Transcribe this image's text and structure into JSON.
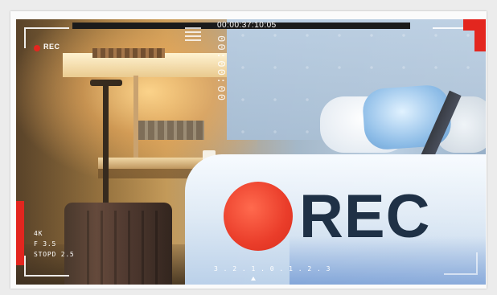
{
  "overlay": {
    "rec_label_small": "REC",
    "timecode": "00:00:37:10:05",
    "vertical_text": "00:00:00",
    "info_line_1": "4K",
    "info_line_2": "F 3.5",
    "info_line_3": "STOPD  2.5",
    "bottom_scale": "3 . 2 . 1 . 0 . 1 . 2 . 3",
    "rec_big": "REC"
  },
  "colors": {
    "rec_red": "#e3261f",
    "rec_text": "#1f3146"
  }
}
